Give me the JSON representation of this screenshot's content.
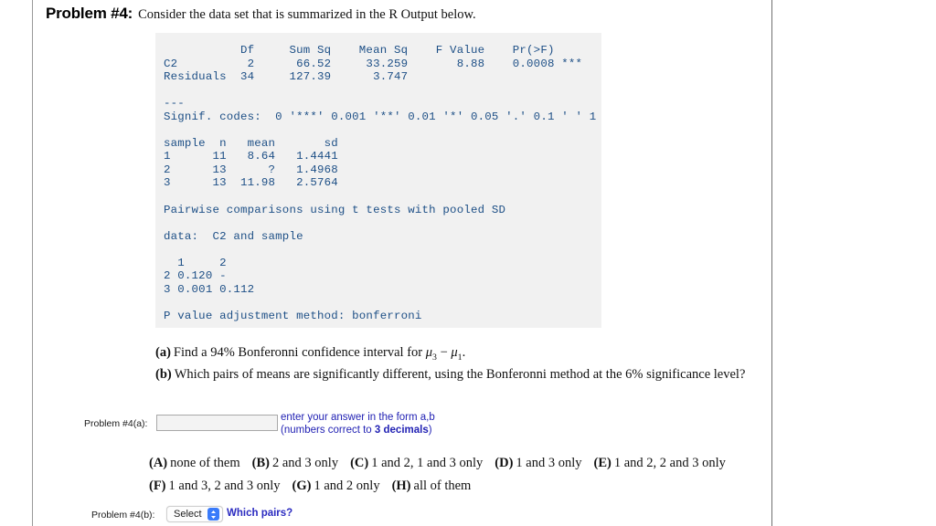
{
  "header": {
    "problem_label": "Problem #4:",
    "statement": "Consider the data set that is summarized in the R Output below."
  },
  "r_output": {
    "text": "           Df     Sum Sq    Mean Sq    F Value    Pr(>F)\nC2          2      66.52     33.259       8.88    0.0008 ***\nResiduals  34     127.39      3.747\n\n---\nSignif. codes:  0 '***' 0.001 '**' 0.01 '*' 0.05 '.' 0.1 ' ' 1\n\nsample  n   mean       sd\n1      11   8.64   1.4441\n2      13      ?   1.4968\n3      13  11.98   2.5764\n\nPairwise comparisons using t tests with pooled SD\n\ndata:  C2 and sample\n\n  1     2\n2 0.120 -\n3 0.001 0.112\n\nP value adjustment method: bonferroni",
    "anova": {
      "columns": [
        "",
        "Df",
        "Sum Sq",
        "Mean Sq",
        "F Value",
        "Pr(>F)"
      ],
      "rows": [
        [
          "C2",
          "2",
          "66.52",
          "33.259",
          "8.88",
          "0.0008 ***"
        ],
        [
          "Residuals",
          "34",
          "127.39",
          "3.747",
          "",
          ""
        ]
      ]
    },
    "signif_codes": "Signif. codes:  0 '***' 0.001 '**' 0.01 '*' 0.05 '.' 0.1 ' ' 1",
    "sample_table": {
      "columns": [
        "sample",
        "n",
        "mean",
        "sd"
      ],
      "rows": [
        [
          "1",
          "11",
          "8.64",
          "1.4441"
        ],
        [
          "2",
          "13",
          "?",
          "1.4968"
        ],
        [
          "3",
          "13",
          "11.98",
          "2.5764"
        ]
      ]
    },
    "pairwise_title": "Pairwise comparisons using t tests with pooled SD",
    "pairwise_data": "data:  C2 and sample",
    "pairwise_matrix": {
      "columns": [
        "",
        "1",
        "2"
      ],
      "rows": [
        [
          "2",
          "0.120",
          "-"
        ],
        [
          "3",
          "0.001",
          "0.112"
        ]
      ]
    },
    "p_adjust": "P value adjustment method: bonferroni"
  },
  "questions": {
    "a_tag": "(a)",
    "a_text_before": "Find a 94% Bonferonni confidence interval for ",
    "a_mu_first": "μ",
    "a_mu_first_sub": "3",
    "a_minus": " − ",
    "a_mu_second": "μ",
    "a_mu_second_sub": "1",
    "a_text_after": ".",
    "b_tag": "(b)",
    "b_text": "Which pairs of means are significantly different, using the Bonferonni method at the 6% significance level?"
  },
  "answer_a": {
    "label": "Problem #4(a):",
    "value": "",
    "placeholder": "",
    "hint_line1": "enter your answer in the form a,b",
    "hint_line2_before": "(numbers correct to ",
    "hint_line2_bold": "3 decimals",
    "hint_line2_after": ")"
  },
  "choices": {
    "row1": [
      {
        "tag": "(A)",
        "text": "none of them"
      },
      {
        "tag": "(B)",
        "text": "2 and 3 only"
      },
      {
        "tag": "(C)",
        "text": "1 and 2, 1 and 3 only"
      },
      {
        "tag": "(D)",
        "text": "1 and 3 only"
      },
      {
        "tag": "(E)",
        "text": "1 and 2, 2 and 3 only"
      }
    ],
    "row2": [
      {
        "tag": "(F)",
        "text": "1 and 3, 2 and 3 only"
      },
      {
        "tag": "(G)",
        "text": "1 and 2 only"
      },
      {
        "tag": "(H)",
        "text": "all of them"
      }
    ]
  },
  "answer_b": {
    "label": "Problem #4(b):",
    "select_value": "Select",
    "link_text": "Which pairs?"
  },
  "colors": {
    "r_output_text": "#1d4f86",
    "r_output_bg": "#f1f1f1",
    "hint_blue": "#2222b4",
    "link_blue": "#2a2ac0",
    "select_accent": "#3a7bfa"
  }
}
